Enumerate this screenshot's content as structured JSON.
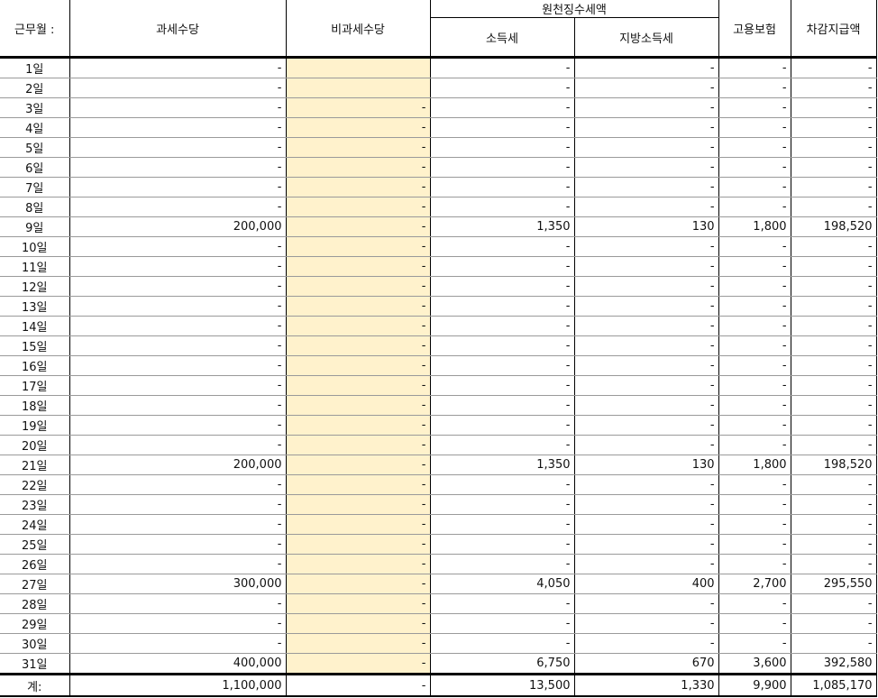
{
  "headers": {
    "month": "근무월 :",
    "taxable": "과세수당",
    "nontaxable": "비과세수당",
    "withholding": "원천징수세액",
    "income_tax": "소득세",
    "local_tax": "지방소득세",
    "employment_insurance": "고용보험",
    "net_pay": "차감지급액"
  },
  "rows": [
    {
      "day": "1일",
      "taxable": "-",
      "nontaxable": "",
      "income_tax": "-",
      "local_tax": "-",
      "emp": "-",
      "net": "-"
    },
    {
      "day": "2일",
      "taxable": "-",
      "nontaxable": "",
      "income_tax": "-",
      "local_tax": "-",
      "emp": "-",
      "net": "-"
    },
    {
      "day": "3일",
      "taxable": "-",
      "nontaxable": "-",
      "income_tax": "-",
      "local_tax": "-",
      "emp": "-",
      "net": "-"
    },
    {
      "day": "4일",
      "taxable": "-",
      "nontaxable": "-",
      "income_tax": "-",
      "local_tax": "-",
      "emp": "-",
      "net": "-"
    },
    {
      "day": "5일",
      "taxable": "-",
      "nontaxable": "-",
      "income_tax": "-",
      "local_tax": "-",
      "emp": "-",
      "net": "-"
    },
    {
      "day": "6일",
      "taxable": "-",
      "nontaxable": "-",
      "income_tax": "-",
      "local_tax": "-",
      "emp": "-",
      "net": "-"
    },
    {
      "day": "7일",
      "taxable": "-",
      "nontaxable": "-",
      "income_tax": "-",
      "local_tax": "-",
      "emp": "-",
      "net": "-"
    },
    {
      "day": "8일",
      "taxable": "-",
      "nontaxable": "-",
      "income_tax": "-",
      "local_tax": "-",
      "emp": "-",
      "net": "-"
    },
    {
      "day": "9일",
      "taxable": "200,000",
      "nontaxable": "-",
      "income_tax": "1,350",
      "local_tax": "130",
      "emp": "1,800",
      "net": "198,520"
    },
    {
      "day": "10일",
      "taxable": "-",
      "nontaxable": "-",
      "income_tax": "-",
      "local_tax": "-",
      "emp": "-",
      "net": "-"
    },
    {
      "day": "11일",
      "taxable": "-",
      "nontaxable": "-",
      "income_tax": "-",
      "local_tax": "-",
      "emp": "-",
      "net": "-"
    },
    {
      "day": "12일",
      "taxable": "-",
      "nontaxable": "-",
      "income_tax": "-",
      "local_tax": "-",
      "emp": "-",
      "net": "-"
    },
    {
      "day": "13일",
      "taxable": "-",
      "nontaxable": "-",
      "income_tax": "-",
      "local_tax": "-",
      "emp": "-",
      "net": "-"
    },
    {
      "day": "14일",
      "taxable": "-",
      "nontaxable": "-",
      "income_tax": "-",
      "local_tax": "-",
      "emp": "-",
      "net": "-"
    },
    {
      "day": "15일",
      "taxable": "-",
      "nontaxable": "-",
      "income_tax": "-",
      "local_tax": "-",
      "emp": "-",
      "net": "-"
    },
    {
      "day": "16일",
      "taxable": "-",
      "nontaxable": "-",
      "income_tax": "-",
      "local_tax": "-",
      "emp": "-",
      "net": "-"
    },
    {
      "day": "17일",
      "taxable": "-",
      "nontaxable": "-",
      "income_tax": "-",
      "local_tax": "-",
      "emp": "-",
      "net": "-"
    },
    {
      "day": "18일",
      "taxable": "-",
      "nontaxable": "-",
      "income_tax": "-",
      "local_tax": "-",
      "emp": "-",
      "net": "-"
    },
    {
      "day": "19일",
      "taxable": "-",
      "nontaxable": "-",
      "income_tax": "-",
      "local_tax": "-",
      "emp": "-",
      "net": "-"
    },
    {
      "day": "20일",
      "taxable": "-",
      "nontaxable": "-",
      "income_tax": "-",
      "local_tax": "-",
      "emp": "-",
      "net": "-"
    },
    {
      "day": "21일",
      "taxable": "200,000",
      "nontaxable": "-",
      "income_tax": "1,350",
      "local_tax": "130",
      "emp": "1,800",
      "net": "198,520"
    },
    {
      "day": "22일",
      "taxable": "-",
      "nontaxable": "-",
      "income_tax": "-",
      "local_tax": "-",
      "emp": "-",
      "net": "-"
    },
    {
      "day": "23일",
      "taxable": "-",
      "nontaxable": "-",
      "income_tax": "-",
      "local_tax": "-",
      "emp": "-",
      "net": "-"
    },
    {
      "day": "24일",
      "taxable": "-",
      "nontaxable": "-",
      "income_tax": "-",
      "local_tax": "-",
      "emp": "-",
      "net": "-"
    },
    {
      "day": "25일",
      "taxable": "-",
      "nontaxable": "-",
      "income_tax": "-",
      "local_tax": "-",
      "emp": "-",
      "net": "-"
    },
    {
      "day": "26일",
      "taxable": "-",
      "nontaxable": "-",
      "income_tax": "-",
      "local_tax": "-",
      "emp": "-",
      "net": "-"
    },
    {
      "day": "27일",
      "taxable": "300,000",
      "nontaxable": "-",
      "income_tax": "4,050",
      "local_tax": "400",
      "emp": "2,700",
      "net": "295,550"
    },
    {
      "day": "28일",
      "taxable": "-",
      "nontaxable": "-",
      "income_tax": "-",
      "local_tax": "-",
      "emp": "-",
      "net": "-"
    },
    {
      "day": "29일",
      "taxable": "-",
      "nontaxable": "-",
      "income_tax": "-",
      "local_tax": "-",
      "emp": "-",
      "net": "-"
    },
    {
      "day": "30일",
      "taxable": "-",
      "nontaxable": "-",
      "income_tax": "-",
      "local_tax": "-",
      "emp": "-",
      "net": "-"
    },
    {
      "day": "31일",
      "taxable": "400,000",
      "nontaxable": "-",
      "income_tax": "6,750",
      "local_tax": "670",
      "emp": "3,600",
      "net": "392,580"
    }
  ],
  "total": {
    "label": "계:",
    "taxable": "1,100,000",
    "nontaxable": "-",
    "income_tax": "13,500",
    "local_tax": "1,330",
    "emp": "9,900",
    "net": "1,085,170"
  }
}
